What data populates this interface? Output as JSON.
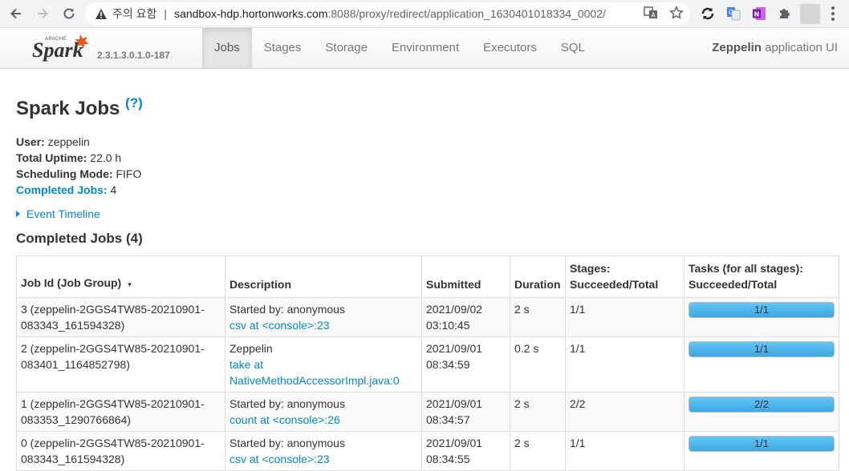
{
  "browser": {
    "warning_text": "주의 요함",
    "url_host": "sandbox-hdp.hortonworks.com",
    "url_path": ":8088/proxy/redirect/application_1630401018334_0002/"
  },
  "navbar": {
    "brand_small": "APACHE",
    "brand_logo": "Spark",
    "version": "2.3.1.3.0.1.0-187",
    "tabs": [
      {
        "label": "Jobs",
        "active": true
      },
      {
        "label": "Stages"
      },
      {
        "label": "Storage"
      },
      {
        "label": "Environment"
      },
      {
        "label": "Executors"
      },
      {
        "label": "SQL"
      }
    ],
    "app_name": "Zeppelin",
    "app_suffix": " application UI"
  },
  "page": {
    "title": "Spark Jobs",
    "help": "(?)",
    "summary": {
      "user_label": "User:",
      "user_value": " zeppelin",
      "uptime_label": "Total Uptime:",
      "uptime_value": " 22.0 h",
      "mode_label": "Scheduling Mode:",
      "mode_value": " FIFO",
      "completed_label": "Completed Jobs:",
      "completed_value": " 4"
    },
    "event_timeline": "Event Timeline",
    "section_title": "Completed Jobs (4)"
  },
  "table": {
    "headers": {
      "job_id": "Job Id (Job Group)",
      "sort_arrow": "▾",
      "description": "Description",
      "submitted": "Submitted",
      "duration": "Duration",
      "stages_line1": "Stages:",
      "stages_line2": "Succeeded/Total",
      "tasks_line1": "Tasks (for all stages):",
      "tasks_line2": "Succeeded/Total"
    },
    "rows": [
      {
        "job_id_line1": "3 (zeppelin-2GGS4TW85-20210901-",
        "job_id_line2": "083343_161594328)",
        "desc_plain": "Started by: anonymous",
        "desc_link1": "csv at <console>:23",
        "desc_link2": "",
        "submitted_date": "2021/09/02",
        "submitted_time": "03:10:45",
        "duration": "2 s",
        "stages": "1/1",
        "tasks": "1/1",
        "tasks_progress": 1.0
      },
      {
        "job_id_line1": "2 (zeppelin-2GGS4TW85-20210901-",
        "job_id_line2": "083401_1164852798)",
        "desc_plain": "Zeppelin",
        "desc_link1": "take at",
        "desc_link2": "NativeMethodAccessorImpl.java:0",
        "submitted_date": "2021/09/01",
        "submitted_time": "08:34:59",
        "duration": "0.2 s",
        "stages": "1/1",
        "tasks": "1/1",
        "tasks_progress": 1.0
      },
      {
        "job_id_line1": "1 (zeppelin-2GGS4TW85-20210901-",
        "job_id_line2": "083353_1290766864)",
        "desc_plain": "Started by: anonymous",
        "desc_link1": "count at <console>:26",
        "desc_link2": "",
        "submitted_date": "2021/09/01",
        "submitted_time": "08:34:57",
        "duration": "2 s",
        "stages": "2/2",
        "tasks": "2/2",
        "tasks_progress": 1.0
      },
      {
        "job_id_line1": "0 (zeppelin-2GGS4TW85-20210901-",
        "job_id_line2": "083343_161594328)",
        "desc_plain": "Started by: anonymous",
        "desc_link1": "csv at <console>:23",
        "desc_link2": "",
        "submitted_date": "2021/09/01",
        "submitted_time": "08:34:55",
        "duration": "2 s",
        "stages": "1/1",
        "tasks": "1/1",
        "tasks_progress": 1.0
      }
    ]
  },
  "colors": {
    "link": "#0088cc",
    "progress_fill": "#3ca8e3",
    "spark_orange": "#e25a1c"
  }
}
